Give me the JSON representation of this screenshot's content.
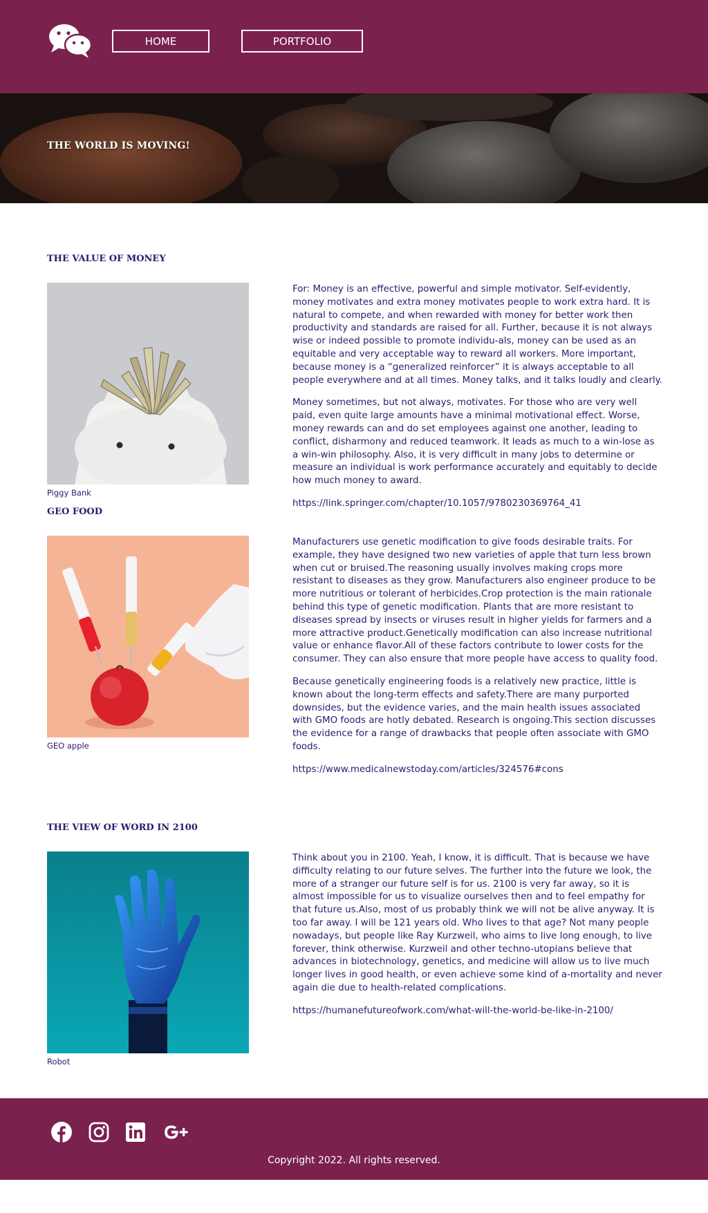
{
  "header": {
    "logo_icon": "wechat-icon",
    "nav": [
      {
        "label": "HOME"
      },
      {
        "label": "PORTFOLIO"
      }
    ],
    "bg_color": "#7a214d"
  },
  "hero": {
    "title": "THE WORLD IS MOVING!",
    "image": "coins-photo"
  },
  "sections": [
    {
      "title": "THE VALUE OF MONEY",
      "image": "piggy-bank-photo",
      "caption": "Piggy Bank",
      "paragraphs": [
        "For: Money is an effective, powerful and simple motivator. Self-evidently, money motivates and extra money motivates people to work extra hard. It is natural to compete, and when rewarded with money for better work then productivity and standards are raised for all. Further, because it is not always wise or indeed possible to promote individu-als, money can be used as an equitable and very acceptable way to reward all workers. More important, because money is a “generalized reinforcer” it is always acceptable to all people everywhere and at all times. Money talks, and it talks loudly and clearly.",
        "Money sometimes, but not always, motivates. For those who are very well paid, even quite large amounts have a minimal motivational effect. Worse, money rewards can and do set employees against one another, leading to conflict, disharmony and reduced teamwork. It leads as much to a win-lose as a win-win philosophy. Also, it is very difficult in many jobs to determine or measure an individual is work performance accurately and equitably to decide how much money to award."
      ],
      "link": "https://link.springer.com/chapter/10.1057/9780230369764_41"
    },
    {
      "title": "GEO FOOD",
      "image": "geo-apple-photo",
      "caption": "GEO apple",
      "paragraphs": [
        "Manufacturers use genetic modification to give foods desirable traits. For example, they have designed two new varieties of apple that turn less brown when cut or bruised.The reasoning usually involves making crops more resistant to diseases as they grow. Manufacturers also engineer produce to be more nutritious or tolerant of herbicides.Crop protection is the main rationale behind this type of genetic modification. Plants that are more resistant to diseases spread by insects or viruses result in higher yields for farmers and a more attractive product.Genetically modification can also increase nutritional value or enhance flavor.All of these factors contribute to lower costs for the consumer. They can also ensure that more people have access to quality food.",
        "Because genetically engineering foods is a relatively new practice, little is known about the long-term effects and safety.There are many purported downsides, but the evidence varies, and the main health issues associated with GMO foods are hotly debated. Research is ongoing.This section discusses the evidence for a range of drawbacks that people often associate with GMO foods."
      ],
      "link": "https://www.medicalnewstoday.com/articles/324576#cons"
    },
    {
      "title": "THE VIEW OF WORD IN 2100",
      "image": "robot-hand-photo",
      "caption": "Robot",
      "paragraphs": [
        "Think about you in 2100. Yeah, I know, it is difficult. That is because we have difficulty relating to our future selves. The further into the future we look, the more of a stranger our future self is for us. 2100 is very far away, so it is almost impossible for us to visualize ourselves then and to feel empathy for that future us.Also, most of us probably think we will not be alive anyway. It is too far away. I will be 121 years old. Who lives to that age? Not many people nowadays, but people like Ray Kurzweil, who aims to live long enough, to live forever, think otherwise. Kurzweil and other techno-utopians believe that advances in biotechnology, genetics, and medicine will allow us to live much longer lives in good health, or even achieve some kind of a-mortality and never again die due to health-related complications."
      ],
      "link": "https://humanefutureofwork.com/what-will-the-world-be-like-in-2100/"
    }
  ],
  "footer": {
    "social_icons": [
      "facebook-icon",
      "instagram-icon",
      "linkedin-icon",
      "google-plus-icon"
    ],
    "copyright": "Copyright 2022. All rights reserved.",
    "bg_color": "#7a214d"
  }
}
